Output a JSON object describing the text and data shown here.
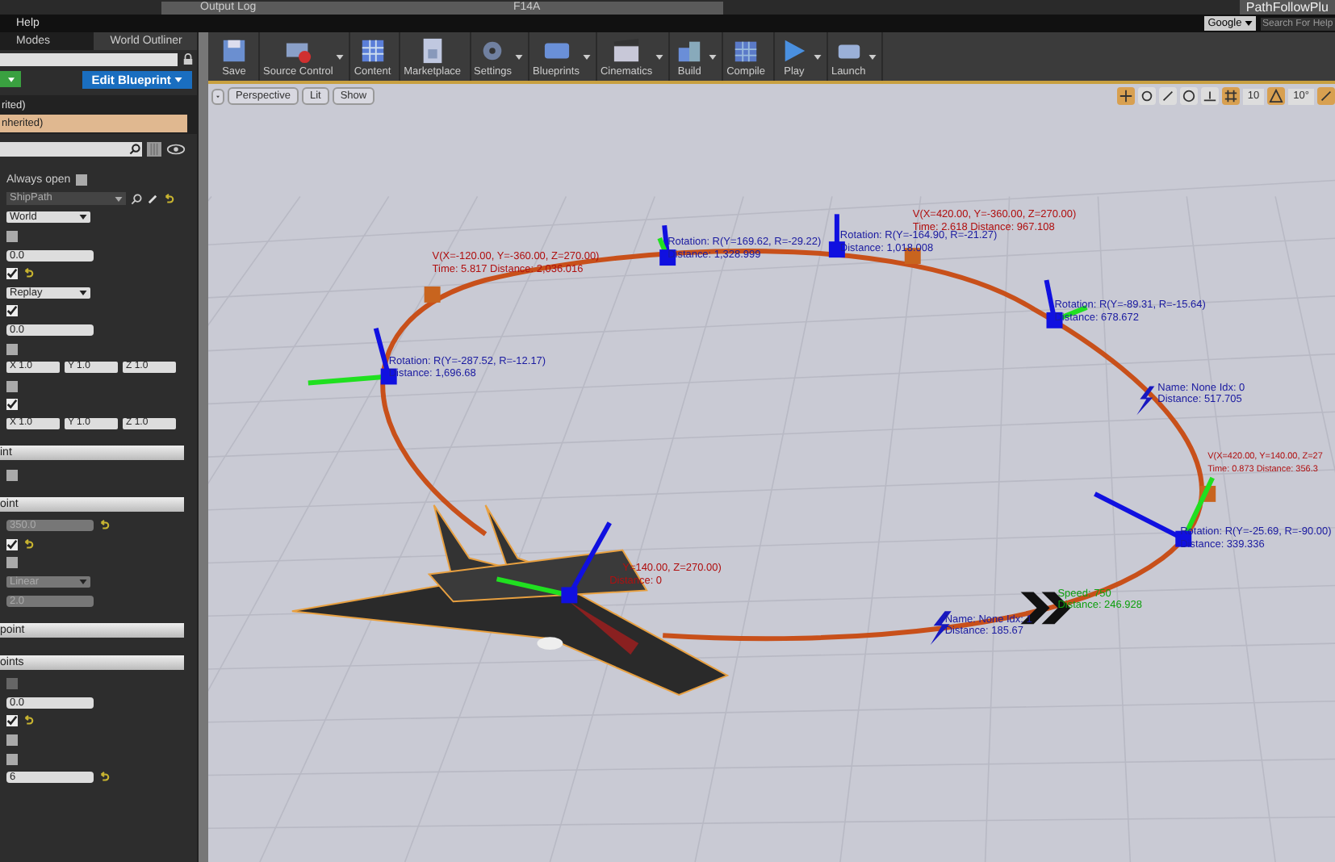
{
  "window": {
    "title": "PathFollowPlu"
  },
  "document_tabs": [
    "Output Log",
    "F14A"
  ],
  "menu": [
    "Help"
  ],
  "help_search": {
    "engine": "Google",
    "placeholder": "Search For Help"
  },
  "panel_tabs": [
    "Modes",
    "World Outliner"
  ],
  "panel": {
    "edit_blueprint": "Edit Blueprint",
    "components": [
      {
        "label": "rited)",
        "selected": false
      },
      {
        "label": "nherited)",
        "selected": true
      }
    ],
    "rows": [
      {
        "kind": "labeled_checkbox",
        "label": "Always open",
        "checked": false
      },
      {
        "kind": "asset",
        "value": "ShipPath"
      },
      {
        "kind": "dropdown",
        "value": "World",
        "disabled": false
      },
      {
        "kind": "checkbox",
        "checked": false,
        "disabled": false,
        "reset": false
      },
      {
        "kind": "number",
        "value": "0.0",
        "disabled": false,
        "reset": false
      },
      {
        "kind": "checkbox",
        "checked": true,
        "disabled": false,
        "reset": true
      },
      {
        "kind": "dropdown",
        "value": "Replay",
        "disabled": false
      },
      {
        "kind": "checkbox",
        "checked": true,
        "disabled": false,
        "reset": false
      },
      {
        "kind": "number",
        "value": "0.0",
        "disabled": false,
        "reset": false
      },
      {
        "kind": "checkbox",
        "checked": false,
        "disabled": false,
        "reset": false
      },
      {
        "kind": "vector",
        "axes": [
          {
            "axis": "X",
            "value": "1.0"
          },
          {
            "axis": "Y",
            "value": "1.0"
          },
          {
            "axis": "Z",
            "value": "1.0"
          }
        ]
      },
      {
        "kind": "checkbox",
        "checked": false,
        "disabled": false,
        "reset": false
      },
      {
        "kind": "checkbox",
        "checked": true,
        "disabled": false,
        "reset": false
      },
      {
        "kind": "vector",
        "axes": [
          {
            "axis": "X",
            "value": "1.0"
          },
          {
            "axis": "Y",
            "value": "1.0"
          },
          {
            "axis": "Z",
            "value": "1.0"
          }
        ]
      },
      {
        "kind": "section",
        "label": "int"
      },
      {
        "kind": "checkbox",
        "checked": false,
        "disabled": false,
        "reset": false
      },
      {
        "kind": "section",
        "label": "oint"
      },
      {
        "kind": "number",
        "value": "350.0",
        "disabled": true,
        "reset": true
      },
      {
        "kind": "checkbox",
        "checked": true,
        "disabled": false,
        "reset": true
      },
      {
        "kind": "checkbox",
        "checked": false,
        "disabled": false,
        "reset": false
      },
      {
        "kind": "dropdown",
        "value": "Linear",
        "disabled": true
      },
      {
        "kind": "number",
        "value": "2.0",
        "disabled": true,
        "reset": false
      },
      {
        "kind": "section",
        "label": "point"
      },
      {
        "kind": "section",
        "label": "oints"
      },
      {
        "kind": "checkbox",
        "checked": false,
        "disabled": true,
        "reset": false
      },
      {
        "kind": "number",
        "value": "0.0",
        "disabled": false,
        "reset": false
      },
      {
        "kind": "checkbox",
        "checked": true,
        "disabled": false,
        "reset": true
      },
      {
        "kind": "checkbox",
        "checked": false,
        "disabled": false,
        "reset": false
      },
      {
        "kind": "checkbox",
        "checked": false,
        "disabled": false,
        "reset": false
      },
      {
        "kind": "number",
        "value": "6",
        "disabled": false,
        "reset": true
      }
    ]
  },
  "toolbar": [
    {
      "label": "Save",
      "kind": "save",
      "dropdown": false
    },
    {
      "label": "Source Control",
      "kind": "source",
      "dropdown": true
    },
    {
      "label": "Content",
      "kind": "content",
      "dropdown": false
    },
    {
      "label": "Marketplace",
      "kind": "market",
      "dropdown": false
    },
    {
      "label": "Settings",
      "kind": "settings",
      "dropdown": true
    },
    {
      "label": "Blueprints",
      "kind": "blueprint",
      "dropdown": true
    },
    {
      "label": "Cinematics",
      "kind": "cinema",
      "dropdown": true
    },
    {
      "label": "Build",
      "kind": "build",
      "dropdown": true
    },
    {
      "label": "Compile",
      "kind": "compile",
      "dropdown": false
    },
    {
      "label": "Play",
      "kind": "play",
      "dropdown": true
    },
    {
      "label": "Launch",
      "kind": "launch",
      "dropdown": true
    }
  ],
  "viewport": {
    "view_mode": "Perspective",
    "lighting": "Lit",
    "show": "Show",
    "grid_snap": "10",
    "rotation_snap": "10°",
    "labels": [
      {
        "kind": "vector",
        "text": "V(X=-120.00, Y=-360.00, Z=270.00)"
      },
      {
        "kind": "vector",
        "text": "Time: 5.817 Distance: 2,036.016"
      },
      {
        "kind": "rotation",
        "text": "Rotation: R(Y=169.62, R=-29.22)"
      },
      {
        "kind": "rotation",
        "text": "Distance: 1,328.999"
      },
      {
        "kind": "rotation",
        "text": "Rotation: R(Y=-164.90, R=-21.27)"
      },
      {
        "kind": "rotation",
        "text": "Distance: 1,018.008"
      },
      {
        "kind": "vector",
        "text": "V(X=420.00, Y=-360.00, Z=270.00)"
      },
      {
        "kind": "vector",
        "text": "Time: 2.618 Distance: 967.108"
      },
      {
        "kind": "rotation",
        "text": "Rotation: R(Y=-287.52, R=-12.17)"
      },
      {
        "kind": "rotation",
        "text": "Distance: 1,696.68"
      },
      {
        "kind": "rotation",
        "text": "Rotation: R(Y=-89.31, R=-15.64)"
      },
      {
        "kind": "rotation",
        "text": "Distance: 678.672"
      },
      {
        "kind": "rotation",
        "text": "Name: None  Idx: 0"
      },
      {
        "kind": "rotation",
        "text": "Distance: 517.705"
      },
      {
        "kind": "vector",
        "text": "V(X=420.00, Y=140.00, Z=27"
      },
      {
        "kind": "vector",
        "text": "Time: 0.873 Distance: 356.3"
      },
      {
        "kind": "rotation",
        "text": "Rotation: R(Y=-25.69, R=-90.00)"
      },
      {
        "kind": "rotation",
        "text": "Distance: 339.336"
      },
      {
        "kind": "speed",
        "text": "Speed: 750"
      },
      {
        "kind": "speed",
        "text": "Distance: 246.928"
      },
      {
        "kind": "rotation",
        "text": "Name: None  Idx: 1"
      },
      {
        "kind": "rotation",
        "text": "Distance: 185.67"
      },
      {
        "kind": "vector",
        "text": "Y=140.00, Z=270.00)"
      },
      {
        "kind": "vector",
        "text": "Distance: 0"
      }
    ]
  }
}
